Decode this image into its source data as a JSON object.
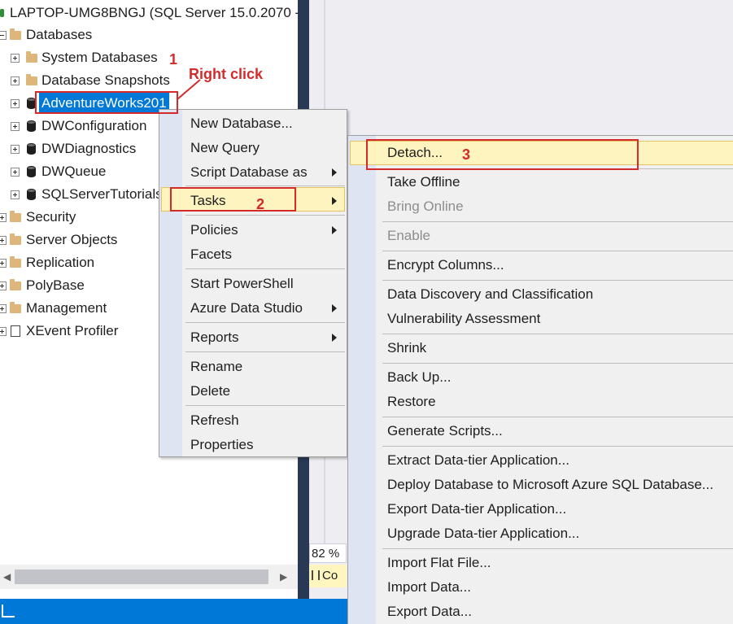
{
  "server_node": "LAPTOP-UMG8BNGJ (SQL Server 15.0.2070 -",
  "tree": {
    "databases": "Databases",
    "system_databases": "System Databases",
    "snapshots": "Database Snapshots",
    "adventureworks": "AdventureWorks201",
    "dwconfiguration": "DWConfiguration",
    "dwdiagnostics": "DWDiagnostics",
    "dwqueue": "DWQueue",
    "sqlservertutorials": "SQLServerTutorials",
    "security": "Security",
    "server_objects": "Server Objects",
    "replication": "Replication",
    "polybase": "PolyBase",
    "management": "Management",
    "xevent": "XEvent Profiler"
  },
  "context_menu": {
    "new_database": "New Database...",
    "new_query": "New Query",
    "script_database_as": "Script Database as",
    "tasks": "Tasks",
    "policies": "Policies",
    "facets": "Facets",
    "start_powershell": "Start PowerShell",
    "azure_data_studio": "Azure Data Studio",
    "reports": "Reports",
    "rename": "Rename",
    "delete": "Delete",
    "refresh": "Refresh",
    "properties": "Properties"
  },
  "tasks_submenu": {
    "detach": "Detach...",
    "take_offline": "Take Offline",
    "bring_online": "Bring Online",
    "enable": "Enable",
    "encrypt_columns": "Encrypt Columns...",
    "data_discovery": "Data Discovery and Classification",
    "vulnerability": "Vulnerability Assessment",
    "shrink": "Shrink",
    "back_up": "Back Up...",
    "restore": "Restore",
    "generate_scripts": "Generate Scripts...",
    "extract_dac": "Extract Data-tier Application...",
    "deploy_azure": "Deploy Database to Microsoft Azure SQL Database...",
    "export_dac": "Export Data-tier Application...",
    "upgrade_dac": "Upgrade Data-tier Application...",
    "import_flat": "Import Flat File...",
    "import_data": "Import Data...",
    "export_data": "Export Data..."
  },
  "zoom": "82 %",
  "status_conn": "Co",
  "annotations": {
    "step1": "1",
    "right_click": "Right click",
    "step2": "2",
    "step3": "3"
  },
  "colors": {
    "highlight": "#fdf4bf",
    "annotation_red": "#d42a2a",
    "selected_blue": "#0078d7",
    "menu_gutter": "#dfe4f2"
  }
}
